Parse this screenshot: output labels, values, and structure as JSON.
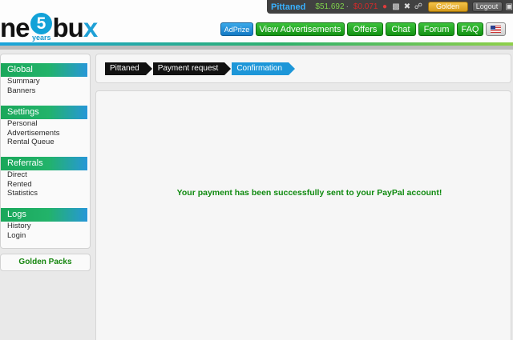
{
  "header": {
    "logo": {
      "prefix": "ne",
      "digit": "5",
      "suffix": "bu",
      "x": "x",
      "tagline": "years"
    },
    "account": {
      "username": "Pittaned",
      "balance": "$51.692",
      "separator": "·",
      "rental_balance": "$0.071",
      "icons": [
        "golden-user-icon",
        "stats-icon",
        "tools-icon",
        "link-icon"
      ],
      "golden_label": "Golden",
      "logout_label": "Logout"
    },
    "nav": {
      "adprize": "AdPrize",
      "view_ads": "View Advertisements",
      "offers": "Offers",
      "chat": "Chat",
      "forum": "Forum",
      "faq": "FAQ"
    }
  },
  "sidebar": {
    "groups": [
      {
        "title": "Global",
        "items": [
          "Summary",
          "Banners"
        ]
      },
      {
        "title": "Settings",
        "items": [
          "Personal",
          "Advertisements",
          "Rental Queue"
        ]
      },
      {
        "title": "Referrals",
        "items": [
          "Direct",
          "Rented",
          "Statistics"
        ]
      },
      {
        "title": "Logs",
        "items": [
          "History",
          "Login"
        ]
      }
    ],
    "golden_packs": "Golden Packs"
  },
  "breadcrumb": [
    "Pittaned",
    "Payment request",
    "Confirmation"
  ],
  "message": "Your payment has been successfully sent to your PayPal account!",
  "colors": {
    "brand_blue": "#1d96d8",
    "brand_green": "#139213",
    "success_text": "#0f8a0f",
    "account_bar": "#414141"
  }
}
